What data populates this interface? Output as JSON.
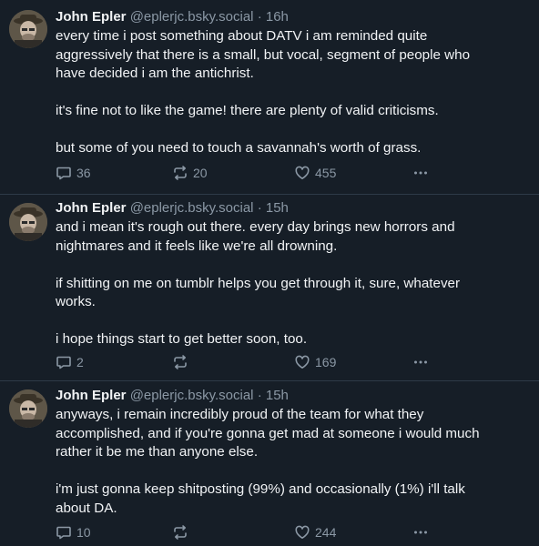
{
  "posts": [
    {
      "author": "John Epler",
      "handle": "@eplerjc.bsky.social",
      "separator": "·",
      "time": "16h",
      "paragraphs": [
        "every time i post something about DATV i am reminded quite aggressively that there is a small, but vocal, segment of people who have decided i am the antichrist.",
        "it's fine not to like the game! there are plenty of valid criticisms.",
        "but some of you need to touch a savannah's worth of grass."
      ],
      "replies": "36",
      "reposts": "20",
      "likes": "455"
    },
    {
      "author": "John Epler",
      "handle": "@eplerjc.bsky.social",
      "separator": "·",
      "time": "15h",
      "paragraphs": [
        "and i mean it's rough out there. every day brings new horrors and nightmares and it feels like we're all drowning.",
        "if shitting on me on tumblr helps you get through it, sure, whatever works.",
        "i hope things start to get better soon, too."
      ],
      "replies": "2",
      "reposts": "",
      "likes": "169"
    },
    {
      "author": "John Epler",
      "handle": "@eplerjc.bsky.social",
      "separator": "·",
      "time": "15h",
      "paragraphs": [
        "anyways, i remain incredibly proud of the team for what they accomplished, and if you're gonna get mad at someone i would much rather it be me than anyone else.",
        "i'm just gonna keep shitposting (99%) and occasionally (1%) i'll talk about DA."
      ],
      "replies": "10",
      "reposts": "",
      "likes": "244"
    }
  ],
  "icons": {
    "reply": "reply-icon",
    "repost": "repost-icon",
    "like": "heart-icon",
    "more": "more-options-icon"
  },
  "colors": {
    "background": "#161e27",
    "text": "#f1f3f5",
    "muted": "#8b98a5",
    "divider": "#2e3a48"
  }
}
